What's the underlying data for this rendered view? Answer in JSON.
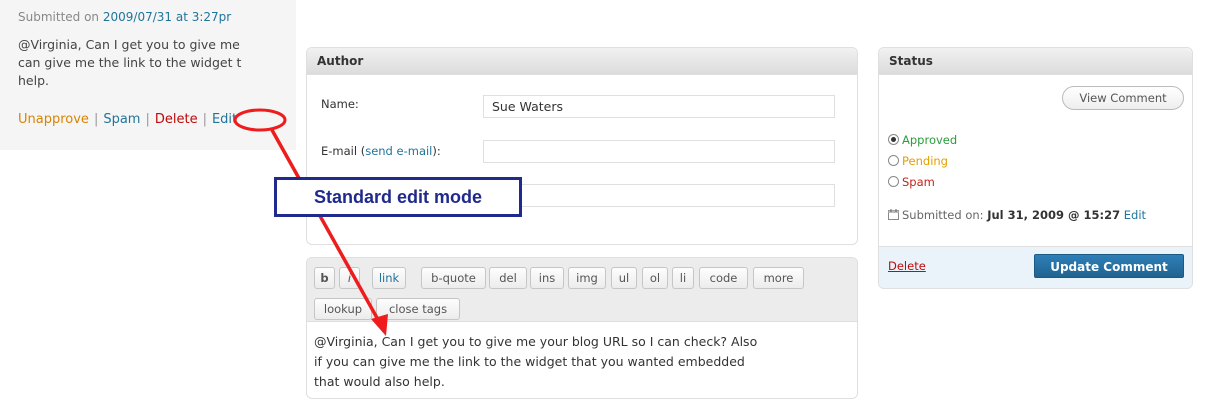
{
  "comment_snippet": {
    "submitted_prefix": "Submitted on ",
    "submitted_link": "2009/07/31 at 3:27pr",
    "lines": [
      "@Virginia, Can I get you to give me",
      "can give me the link to the widget t",
      "help."
    ],
    "actions": {
      "unapprove": "Unapprove",
      "spam": "Spam",
      "delete": "Delete",
      "edit": "Edit",
      "separator": "|"
    }
  },
  "author_box": {
    "title": "Author",
    "name_label": "Name:",
    "name_value": "Sue Waters",
    "email_label_prefix": "E-mail (",
    "email_link": "send e-mail",
    "email_label_suffix": "):",
    "email_value": "",
    "url_value": ""
  },
  "editor": {
    "quicktags_row1": [
      "b",
      "i",
      "link",
      "b-quote",
      "del",
      "ins",
      "img",
      "ul",
      "ol",
      "li",
      "code",
      "more"
    ],
    "quicktags_row2": [
      "lookup",
      "close tags"
    ],
    "text_lines": [
      "@Virginia, Can I get you to give me your blog URL so I can check?  Also",
      "if you can give me the link to the widget that you wanted embedded",
      "that would also help."
    ]
  },
  "status_box": {
    "title": "Status",
    "view_comment": "View Comment",
    "options": [
      "Approved",
      "Pending",
      "Spam"
    ],
    "selected": "Approved",
    "submitted_prefix": "Submitted on: ",
    "submitted_date": "Jul 31, 2009 @ 15:27",
    "submitted_edit": "Edit",
    "delete": "Delete",
    "update_button": "Update Comment"
  },
  "annotation": {
    "callout_text": "Standard edit mode",
    "color": "#ee1c1c"
  },
  "colors": {
    "link": "#21759b",
    "approved": "#2a9d3a",
    "pending": "#e69d00",
    "spam": "#c0261d",
    "button": "#21638f"
  }
}
